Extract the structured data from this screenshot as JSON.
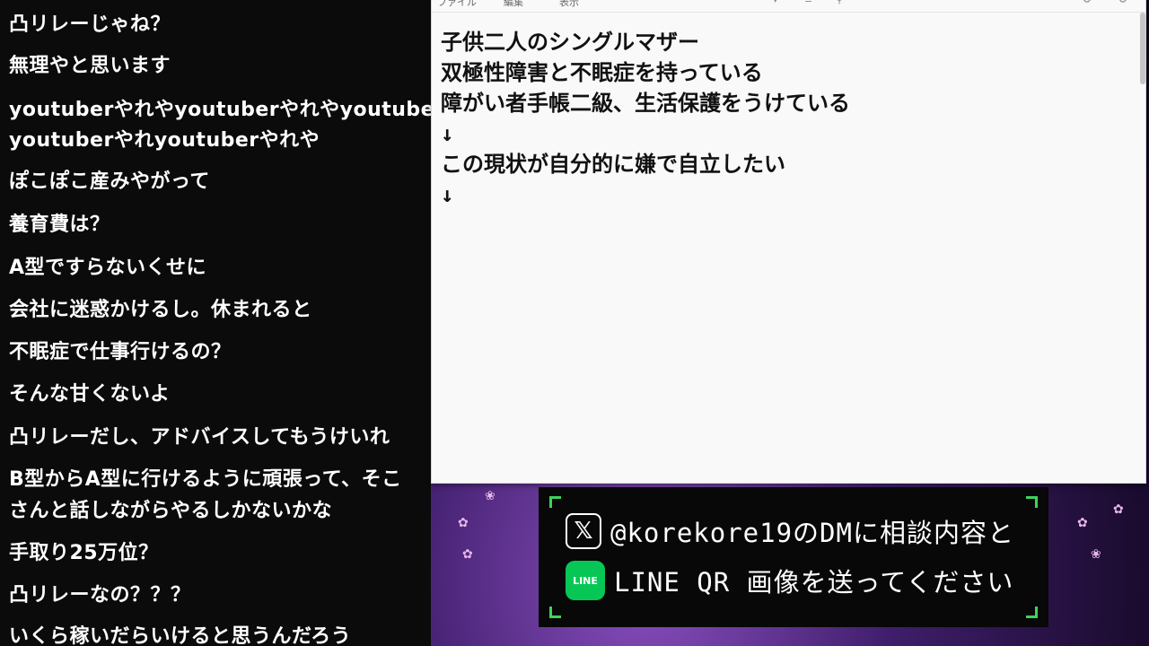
{
  "chat": {
    "messages": [
      "凸リレーじゃね？",
      "無理やと思います",
      "youtuberやれやyoutuberやれやyoutuber",
      "youtuberやれyoutuberやれや",
      "ぽこぽこ産みやがって",
      "養育費は？",
      "A型ですらないくせに",
      "会社に迷惑かけるし。休まれると",
      "不眠症で仕事行けるの？",
      "そんな甘くないよ",
      "凸リレーだし、アドバイスしてもうけいれ",
      "B型からA型に行けるように頑張って、そこ",
      "さんと話しながらやるしかないかな",
      "手取り25万位？",
      "凸リレーなの？？？",
      "いくら稼いだらいけると思うんだろう"
    ]
  },
  "notepad": {
    "menu": [
      "ファイル",
      "編集",
      "表示"
    ],
    "lines": [
      "子供二人のシングルマザー",
      "双極性障害と不眠症を持っている",
      "障がい者手帳二級、生活保護をうけている",
      "↓",
      "この現状が自分的に嫌で自立したい",
      "↓"
    ]
  },
  "promo": {
    "line1": "@korekore19のDMに相談内容と",
    "line2": "LINE QR 画像を送ってください",
    "x_icon_glyph": "𝕏",
    "line_icon_label": "LINE",
    "accent": "#3ed35c",
    "line_green": "#06c755"
  }
}
